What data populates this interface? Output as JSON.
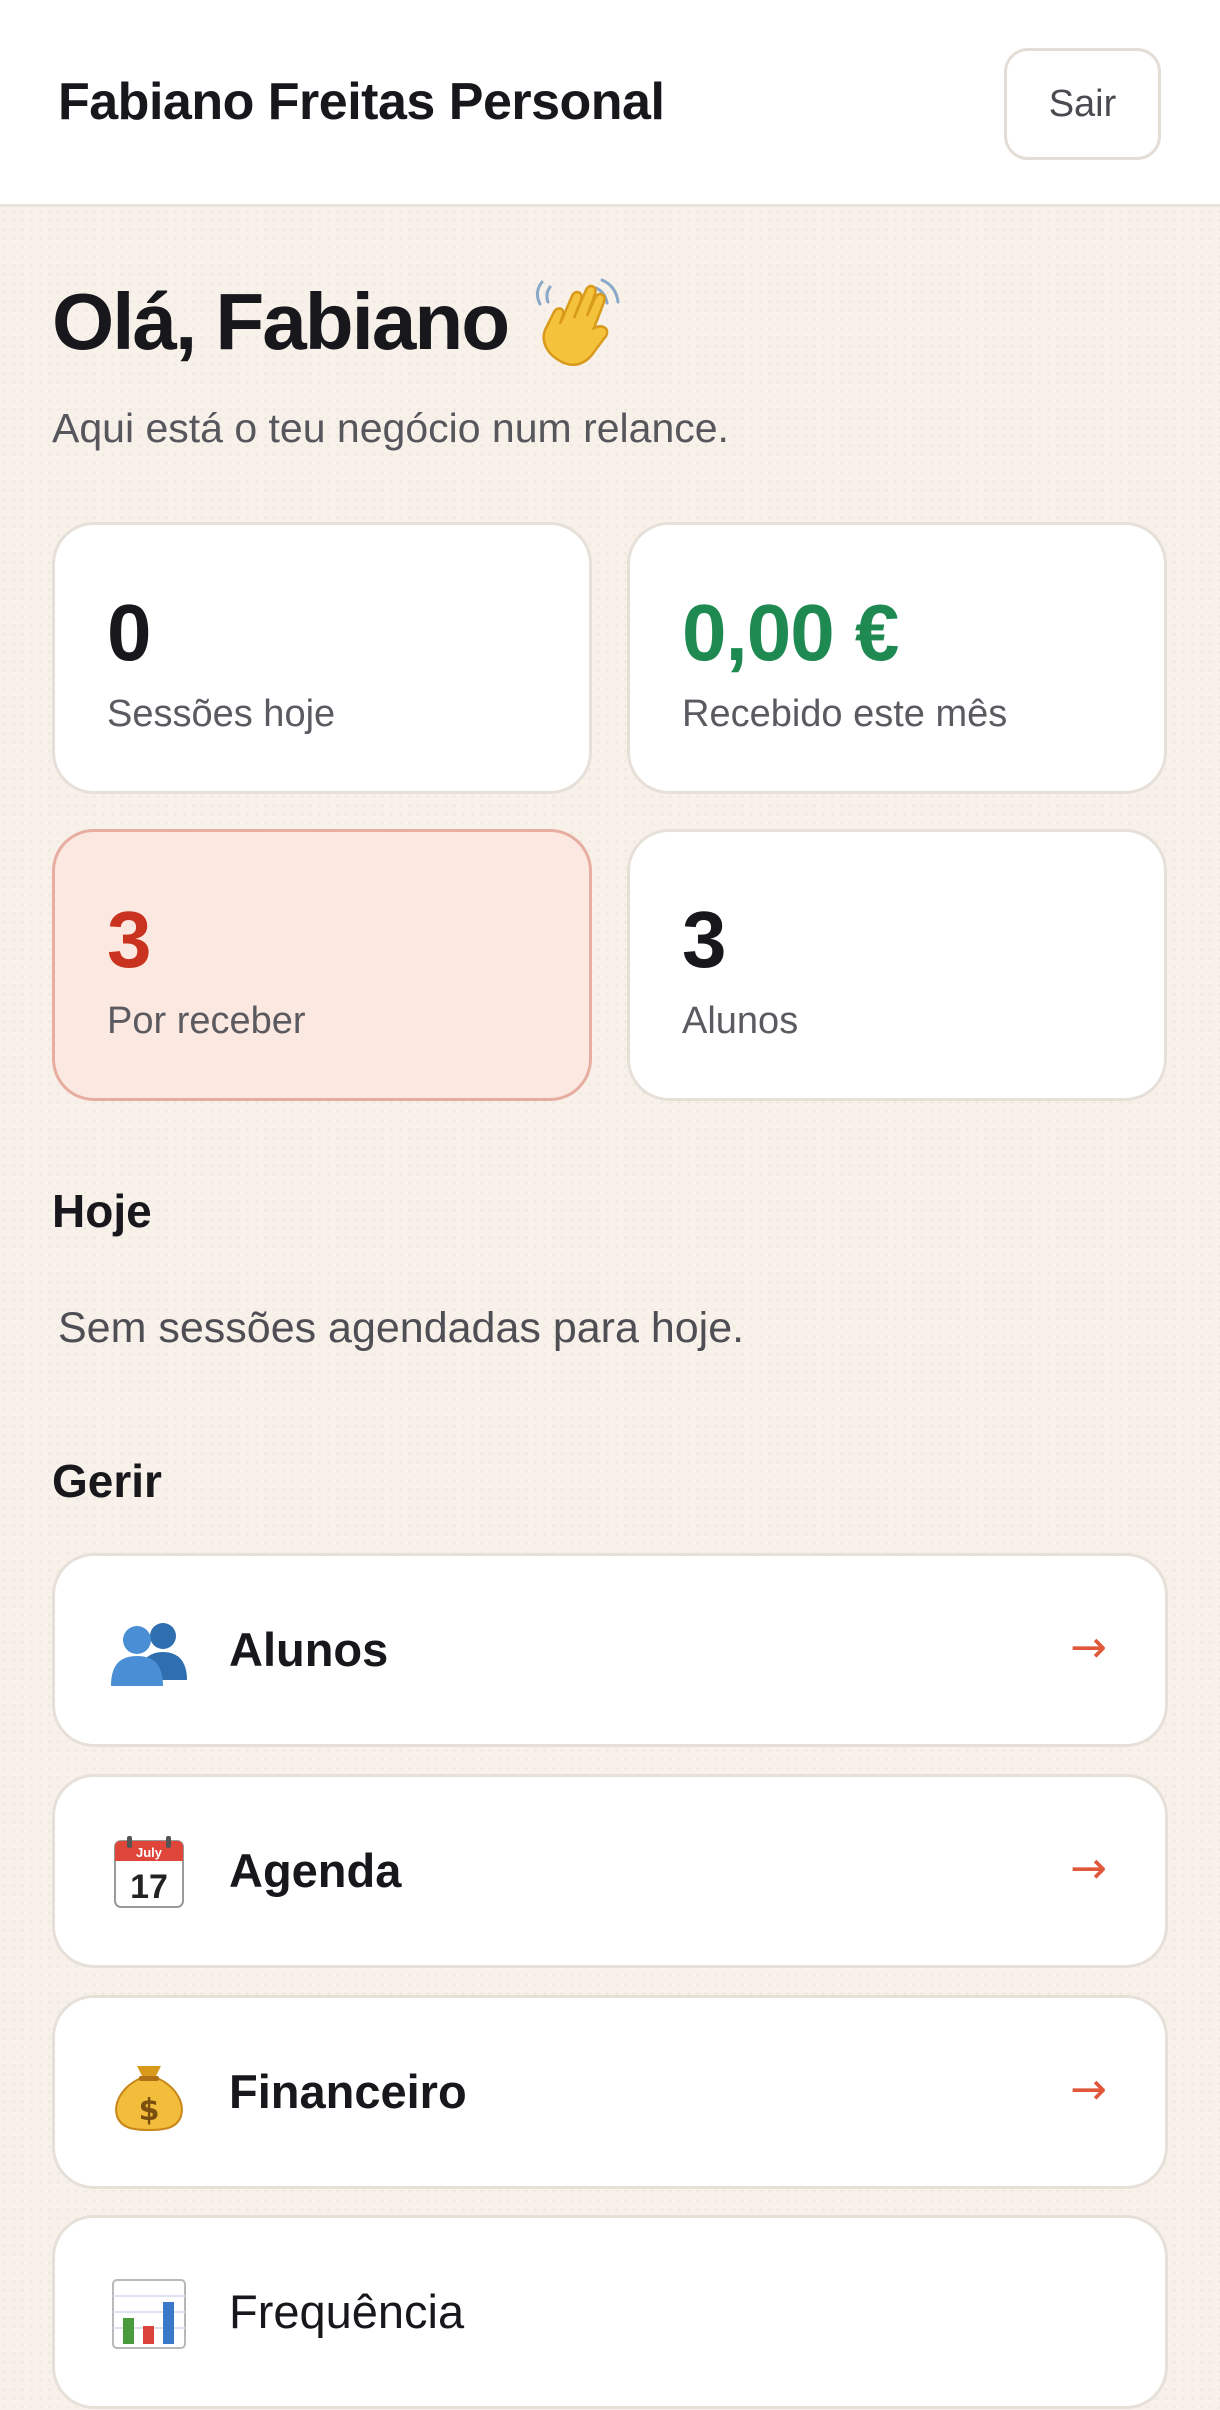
{
  "header": {
    "brand": "Fabiano Freitas Personal",
    "logout_label": "Sair"
  },
  "greeting": {
    "title": "Olá, Fabiano",
    "subtitle": "Aqui está o teu negócio num relance."
  },
  "stats": [
    {
      "value": "0",
      "label": "Sessões hoje"
    },
    {
      "value": "0,00 €",
      "label": "Recebido este mês",
      "color": "#1e8a52"
    },
    {
      "value": "3",
      "label": "Por receber",
      "color": "#c9321e"
    },
    {
      "value": "3",
      "label": "Alunos"
    }
  ],
  "today": {
    "title": "Hoje",
    "empty_message": "Sem sessões agendadas para hoje."
  },
  "manage": {
    "title": "Gerir",
    "items": [
      {
        "label": "Alunos",
        "icon": "people-icon",
        "arrow": "→"
      },
      {
        "label": "Agenda",
        "icon": "calendar-icon",
        "calendar_month": "July",
        "calendar_day": "17",
        "arrow": "→"
      },
      {
        "label": "Financeiro",
        "icon": "money-bag-icon",
        "arrow": "→"
      },
      {
        "label": "Frequência",
        "icon": "bar-chart-icon"
      }
    ]
  }
}
